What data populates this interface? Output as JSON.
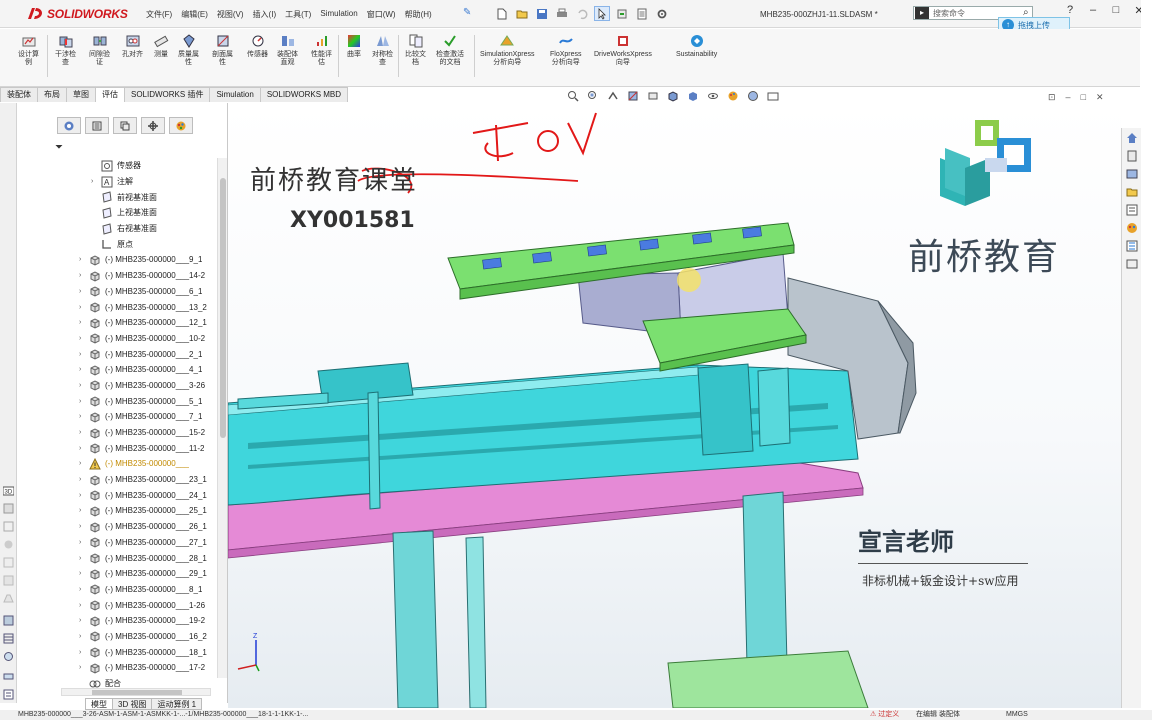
{
  "app": {
    "brand": "SOLIDWORKS",
    "doc_title": "MHB235-000ZHJ1-11.SLDASM *",
    "search_placeholder": "搜索命令",
    "upload_tip": "拖拽上传"
  },
  "menu": [
    "文件(F)",
    "编辑(E)",
    "视图(V)",
    "插入(I)",
    "工具(T)",
    "Simulation",
    "窗口(W)",
    "帮助(H)"
  ],
  "commands": [
    {
      "label": "设计算\n例"
    },
    {
      "label": "干涉检\n查"
    },
    {
      "label": "间隙验\n证"
    },
    {
      "label": "孔对齐"
    },
    {
      "label": "测量"
    },
    {
      "label": "质量属\n性"
    },
    {
      "label": "剖面属\n性"
    },
    {
      "label": "传感器"
    },
    {
      "label": "装配体\n直观"
    },
    {
      "label": "性能评\n估"
    },
    {
      "label": "曲率"
    },
    {
      "label": "对称检\n查"
    },
    {
      "label": "比较文\n档"
    },
    {
      "label": "检查激活\n的文档"
    },
    {
      "label": "SimulationXpress\n分析向导"
    },
    {
      "label": "FloXpress\n分析向导"
    },
    {
      "label": "DriveWorksXpress\n向导"
    },
    {
      "label": "Sustainability"
    }
  ],
  "tabs": [
    {
      "label": "装配体",
      "active": false
    },
    {
      "label": "布局",
      "active": false
    },
    {
      "label": "草图",
      "active": false
    },
    {
      "label": "评估",
      "active": true
    },
    {
      "label": "SOLIDWORKS 插件",
      "active": false
    },
    {
      "label": "Simulation",
      "active": false
    },
    {
      "label": "SOLIDWORKS MBD",
      "active": false
    }
  ],
  "tree": [
    {
      "label": "传感器",
      "icon": "sensor-icon",
      "arrow": "",
      "indent": 1
    },
    {
      "label": "注解",
      "icon": "annotation-icon",
      "arrow": "›",
      "indent": 1
    },
    {
      "label": "前视基准面",
      "icon": "plane-icon",
      "arrow": "",
      "indent": 1
    },
    {
      "label": "上视基准面",
      "icon": "plane-icon",
      "arrow": "",
      "indent": 1
    },
    {
      "label": "右视基准面",
      "icon": "plane-icon",
      "arrow": "",
      "indent": 1
    },
    {
      "label": "原点",
      "icon": "origin-icon",
      "arrow": "",
      "indent": 1
    },
    {
      "label": "(-) MHB235-000000___9_1",
      "icon": "component-icon",
      "arrow": "›",
      "indent": 0
    },
    {
      "label": "(-) MHB235-000000___14-2",
      "icon": "component-icon",
      "arrow": "›",
      "indent": 0
    },
    {
      "label": "(-) MHB235-000000___6_1",
      "icon": "component-icon",
      "arrow": "›",
      "indent": 0
    },
    {
      "label": "(-) MHB235-000000___13_2",
      "icon": "component-icon",
      "arrow": "›",
      "indent": 0
    },
    {
      "label": "(-) MHB235-000000___12_1",
      "icon": "component-icon",
      "arrow": "›",
      "indent": 0
    },
    {
      "label": "(-) MHB235-000000___10-2",
      "icon": "component-icon",
      "arrow": "›",
      "indent": 0
    },
    {
      "label": "(-) MHB235-000000___2_1",
      "icon": "component-icon",
      "arrow": "›",
      "indent": 0
    },
    {
      "label": "(-) MHB235-000000___4_1",
      "icon": "component-icon",
      "arrow": "›",
      "indent": 0
    },
    {
      "label": "(-) MHB235-000000___3-26",
      "icon": "component-icon",
      "arrow": "›",
      "indent": 0
    },
    {
      "label": "(-) MHB235-000000___5_1",
      "icon": "component-icon",
      "arrow": "›",
      "indent": 0
    },
    {
      "label": "(-) MHB235-000000___7_1",
      "icon": "component-icon",
      "arrow": "›",
      "indent": 0
    },
    {
      "label": "(-) MHB235-000000___15-2",
      "icon": "component-icon",
      "arrow": "›",
      "indent": 0
    },
    {
      "label": "(-) MHB235-000000___11-2",
      "icon": "component-icon",
      "arrow": "›",
      "indent": 0
    },
    {
      "label": "(-) MHB235-000000___",
      "icon": "warning-icon",
      "arrow": "›",
      "indent": 0,
      "warn": true
    },
    {
      "label": "(-) MHB235-000000___23_1",
      "icon": "component-icon",
      "arrow": "›",
      "indent": 0
    },
    {
      "label": "(-) MHB235-000000___24_1",
      "icon": "component-icon",
      "arrow": "›",
      "indent": 0
    },
    {
      "label": "(-) MHB235-000000___25_1",
      "icon": "component-icon",
      "arrow": "›",
      "indent": 0
    },
    {
      "label": "(-) MHB235-000000___26_1",
      "icon": "component-icon",
      "arrow": "›",
      "indent": 0
    },
    {
      "label": "(-) MHB235-000000___27_1",
      "icon": "component-icon",
      "arrow": "›",
      "indent": 0
    },
    {
      "label": "(-) MHB235-000000___28_1",
      "icon": "component-icon",
      "arrow": "›",
      "indent": 0
    },
    {
      "label": "(-) MHB235-000000___29_1",
      "icon": "component-icon",
      "arrow": "›",
      "indent": 0
    },
    {
      "label": "(-) MHB235-000000___8_1",
      "icon": "component-icon",
      "arrow": "›",
      "indent": 0
    },
    {
      "label": "(-) MHB235-000000___1-26",
      "icon": "component-icon",
      "arrow": "›",
      "indent": 0
    },
    {
      "label": "(-) MHB235-000000___19-2",
      "icon": "component-icon",
      "arrow": "›",
      "indent": 0
    },
    {
      "label": "(-) MHB235-000000___16_2",
      "icon": "component-icon",
      "arrow": "›",
      "indent": 0
    },
    {
      "label": "(-) MHB235-000000___18_1",
      "icon": "component-icon",
      "arrow": "›",
      "indent": 0
    },
    {
      "label": "(-) MHB235-000000___17-2",
      "icon": "component-icon",
      "arrow": "›",
      "indent": 0
    },
    {
      "label": "配合",
      "icon": "mates-icon",
      "arrow": "",
      "indent": 0
    }
  ],
  "bottom_tabs": [
    {
      "label": "模型",
      "active": true
    },
    {
      "label": "3D 视图",
      "active": false
    },
    {
      "label": "运动算例 1",
      "active": false
    }
  ],
  "status": {
    "path": "MHB235-000000___3-26-ASM-1-ASM-1-ASMKK-1-...-1/MHB235-000000___18-1-1-1KK-1-...",
    "overdefined": "过定义",
    "editing": "在编辑 装配体",
    "units": "MMGS"
  },
  "watermark": {
    "course": "前桥教育课堂",
    "code": "XY001581",
    "logo_text": "前桥教育",
    "teacher": "宣言老师",
    "slogan": "非标机械+钣金设计+sw应用",
    "handwritten": "ToDo"
  },
  "colors": {
    "brand_red": "#d0191f",
    "model_cyan": "#3fd6dc",
    "model_green": "#7be070",
    "model_pink": "#e58ad6",
    "model_lavender": "#c9cce8",
    "annotation_red": "#e21818"
  }
}
